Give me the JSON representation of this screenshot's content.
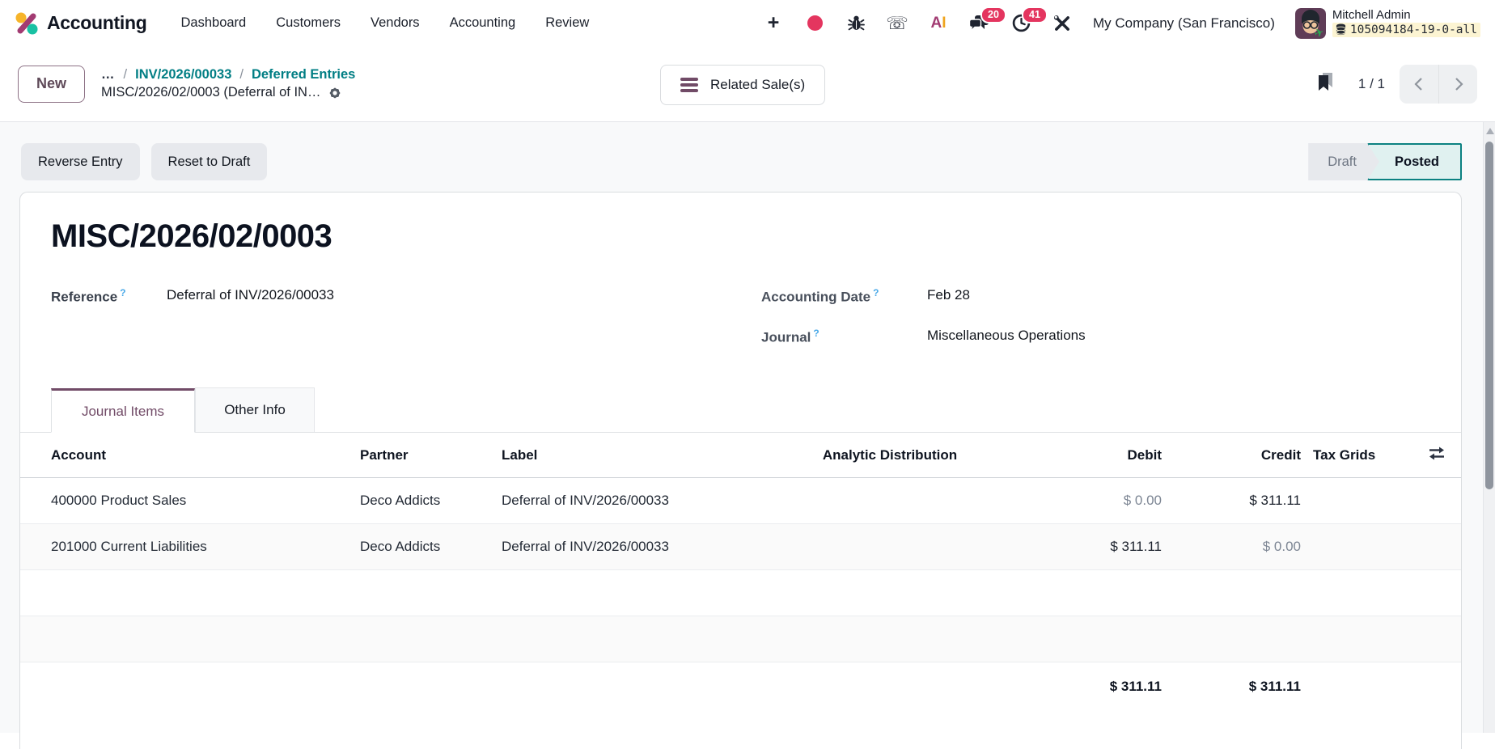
{
  "colors": {
    "brand_purple": "#714B67",
    "link_teal": "#017E84",
    "badge_red": "#E4355F",
    "posted_teal": "#0C8181",
    "db_highlight": "#FCF4D2"
  },
  "nav": {
    "app_name": "Accounting",
    "menu": [
      "Dashboard",
      "Customers",
      "Vendors",
      "Accounting",
      "Review"
    ],
    "systray": {
      "messages_badge": "20",
      "activities_badge": "41",
      "company": "My Company (San Francisco)",
      "user_name": "Mitchell Admin",
      "db_info": "105094184-19-0-all"
    }
  },
  "control_panel": {
    "new_button": "New",
    "breadcrumb": {
      "ellipsis": "…",
      "separator": "/",
      "links": [
        "INV/2026/00033",
        "Deferred Entries"
      ],
      "current": "MISC/2026/02/0003 (Deferral of IN…"
    },
    "related_button": "Related Sale(s)",
    "pager": "1 / 1"
  },
  "statusbar": {
    "buttons": [
      "Reverse Entry",
      "Reset to Draft"
    ],
    "states": [
      {
        "label": "Draft",
        "active": false
      },
      {
        "label": "Posted",
        "active": true
      }
    ]
  },
  "sheet": {
    "title": "MISC/2026/02/0003",
    "help_marker": "?",
    "fields": {
      "reference": {
        "label": "Reference",
        "value": "Deferral of INV/2026/00033"
      },
      "accounting_date": {
        "label": "Accounting Date",
        "value": "Feb 28"
      },
      "journal": {
        "label": "Journal",
        "value": "Miscellaneous Operations"
      }
    },
    "tabs": [
      {
        "label": "Journal Items",
        "active": true
      },
      {
        "label": "Other Info",
        "active": false
      }
    ],
    "table": {
      "columns": [
        "Account",
        "Partner",
        "Label",
        "Analytic Distribution",
        "Debit",
        "Credit",
        "Tax Grids"
      ],
      "rows": [
        {
          "account": "400000 Product Sales",
          "partner": "Deco Addicts",
          "label": "Deferral of INV/2026/00033",
          "debit": "$ 0.00",
          "credit": "$ 311.11"
        },
        {
          "account": "201000 Current Liabilities",
          "partner": "Deco Addicts",
          "label": "Deferral of INV/2026/00033",
          "debit": "$ 311.11",
          "credit": "$ 0.00"
        }
      ],
      "totals": {
        "debit": "$ 311.11",
        "credit": "$ 311.11"
      }
    }
  }
}
